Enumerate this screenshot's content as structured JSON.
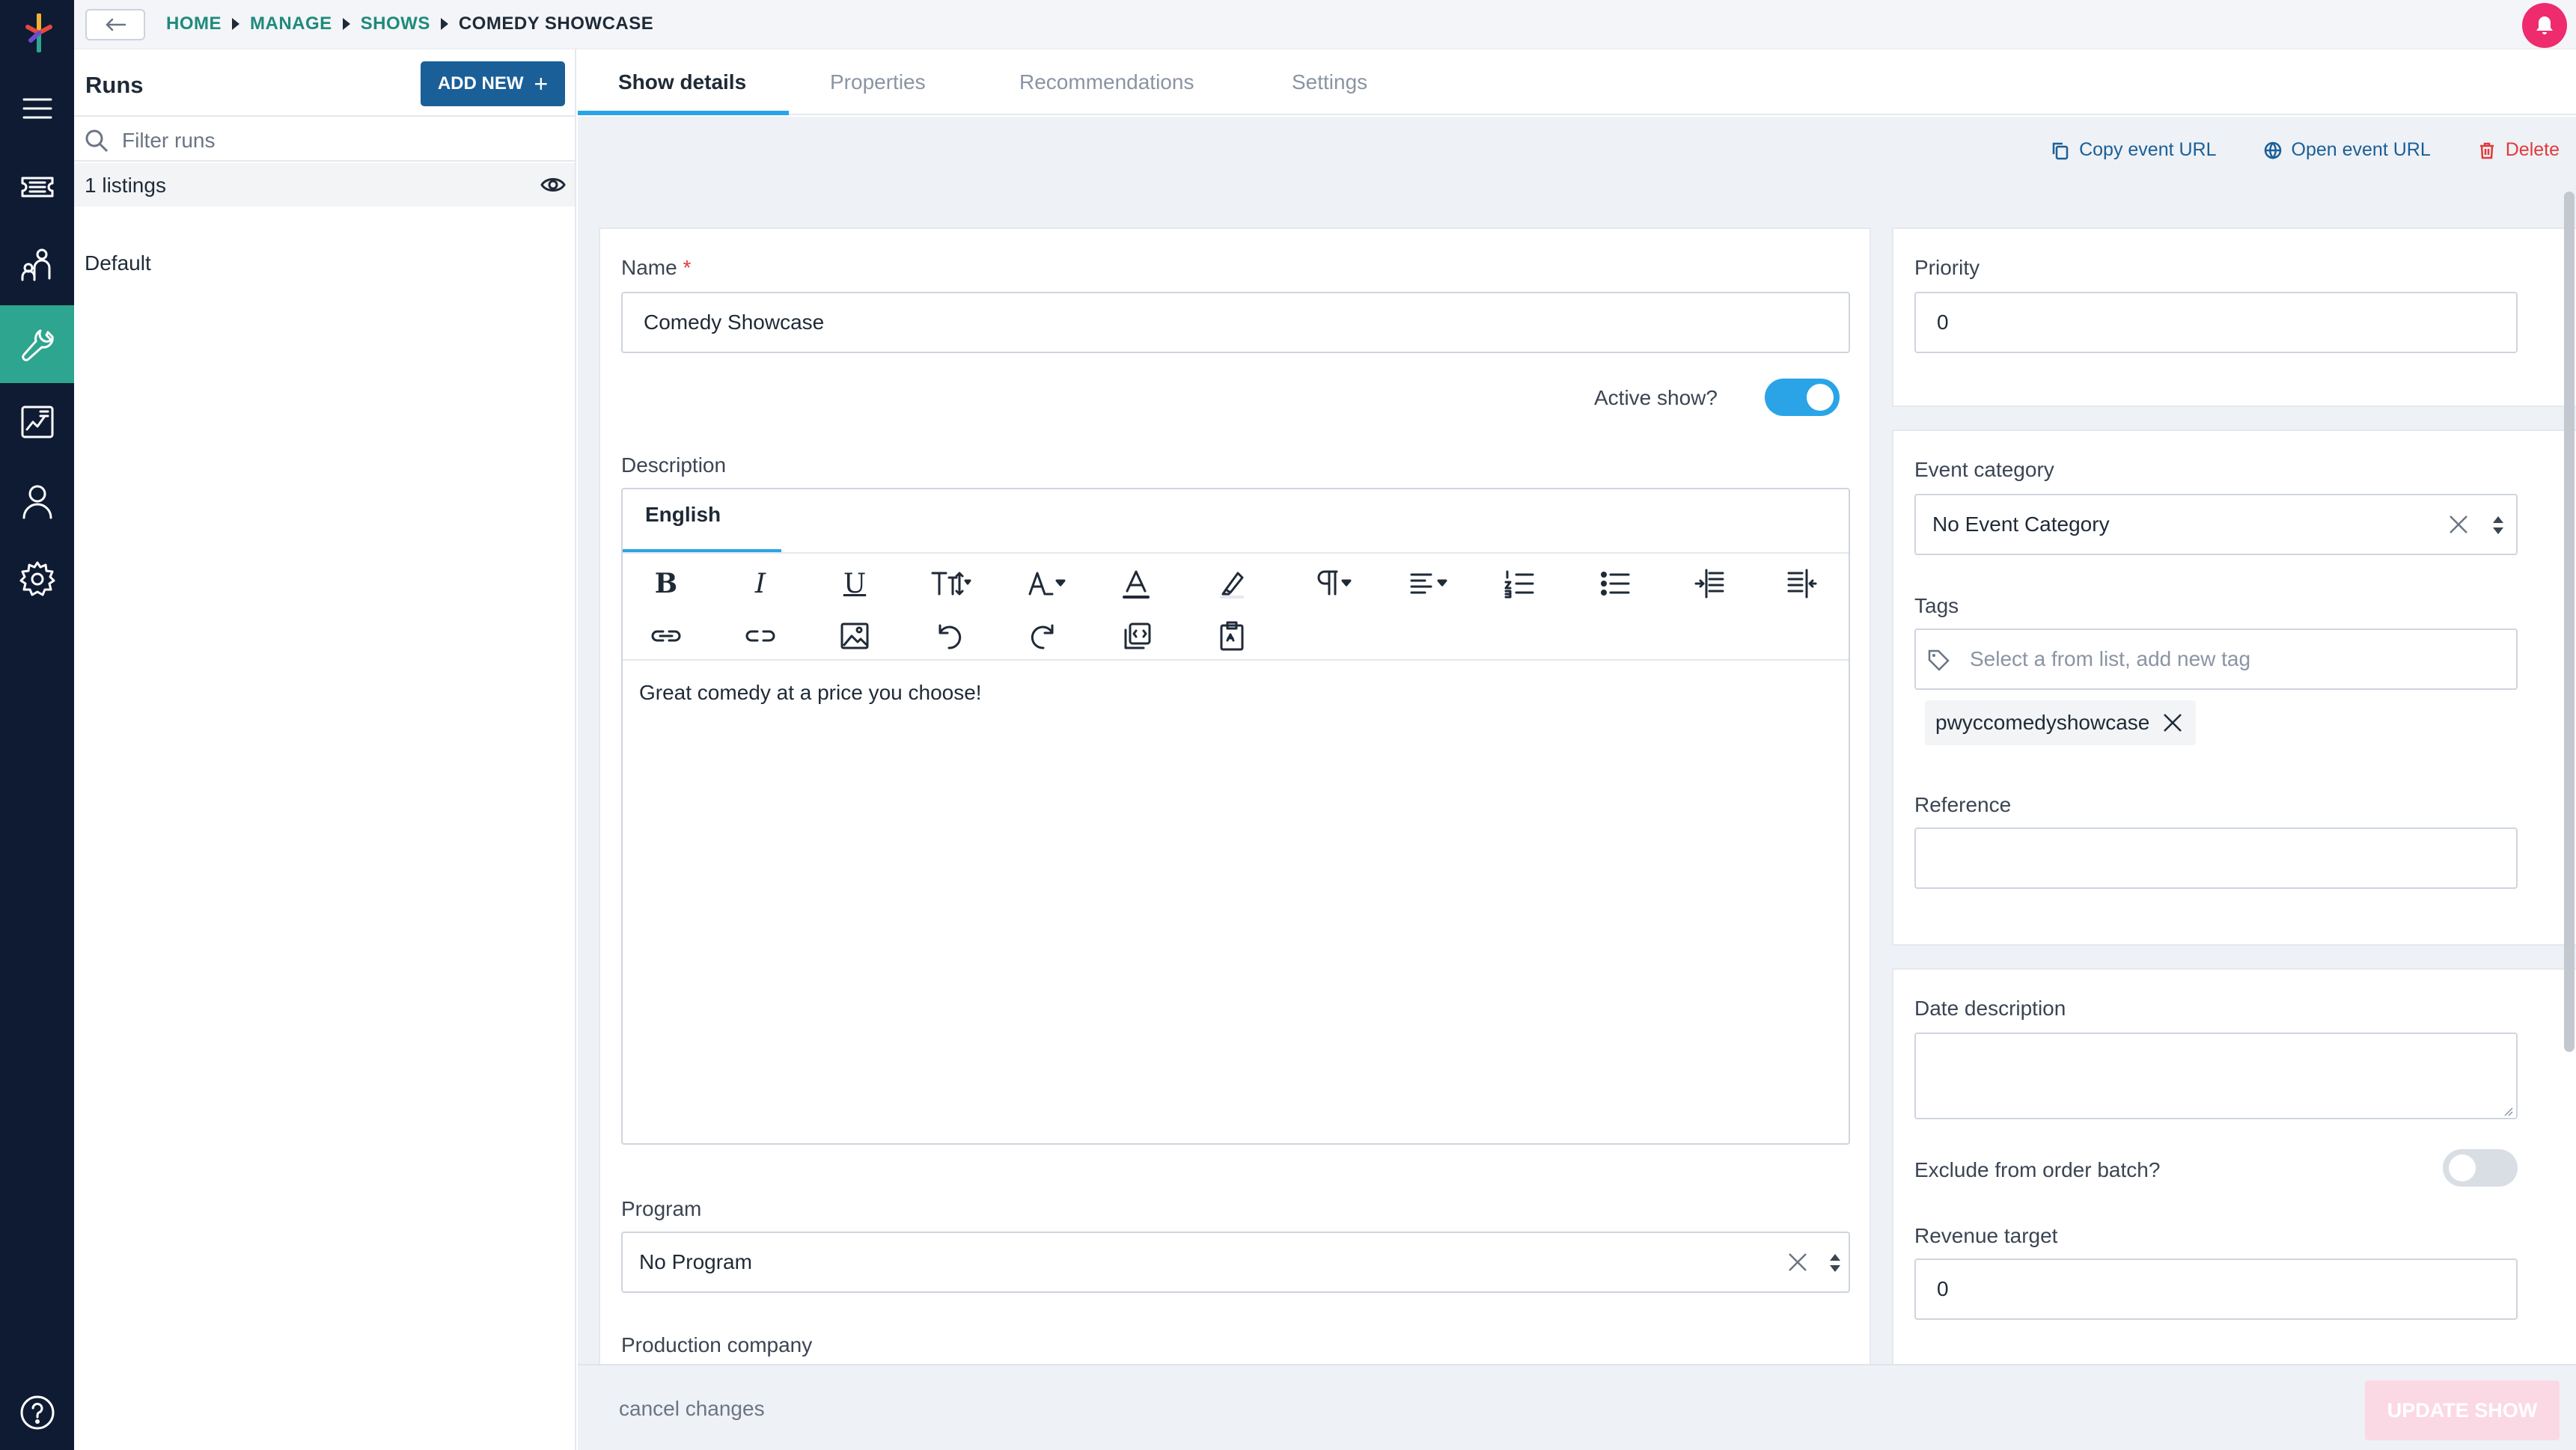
{
  "breadcrumb": [
    "HOME",
    "MANAGE",
    "SHOWS",
    "COMEDY SHOWCASE"
  ],
  "runs": {
    "title": "Runs",
    "add_new_label": "ADD NEW",
    "filter_placeholder": "Filter runs",
    "listings_label": "1 listings",
    "items": [
      "Default"
    ]
  },
  "tabs": [
    "Show details",
    "Properties",
    "Recommendations",
    "Settings"
  ],
  "active_tab": "Show details",
  "actions": {
    "copy_url": "Copy event URL",
    "open_url": "Open event URL",
    "delete": "Delete"
  },
  "form": {
    "name_label": "Name",
    "name_required_marker": "*",
    "name_value": "Comedy Showcase",
    "active_show_label": "Active show?",
    "active_show": true,
    "description_label": "Description",
    "description_language_tab": "English",
    "description_text": "Great comedy at a price you choose!",
    "program_label": "Program",
    "program_value": "No Program",
    "production_company_label": "Production company"
  },
  "sidebar_form": {
    "priority_label": "Priority",
    "priority_value": "0",
    "event_category_label": "Event category",
    "event_category_value": "No Event Category",
    "tags_label": "Tags",
    "tags_placeholder": "Select a from list, add new tag",
    "tags": [
      "pwyccomedyshowcase"
    ],
    "reference_label": "Reference",
    "reference_value": "",
    "date_description_label": "Date description",
    "date_description_value": "",
    "exclude_batch_label": "Exclude from order batch?",
    "exclude_batch": false,
    "revenue_target_label": "Revenue target",
    "revenue_target_value": "0"
  },
  "footer": {
    "cancel_label": "cancel changes",
    "update_label": "UPDATE SHOW"
  },
  "colors": {
    "rail": "#0e1b33",
    "rail_active": "#2ea58e",
    "primary_button": "#1a5f97",
    "accent": "#2aa4e6",
    "danger": "#e03a3a",
    "notification": "#ee2b6c"
  }
}
